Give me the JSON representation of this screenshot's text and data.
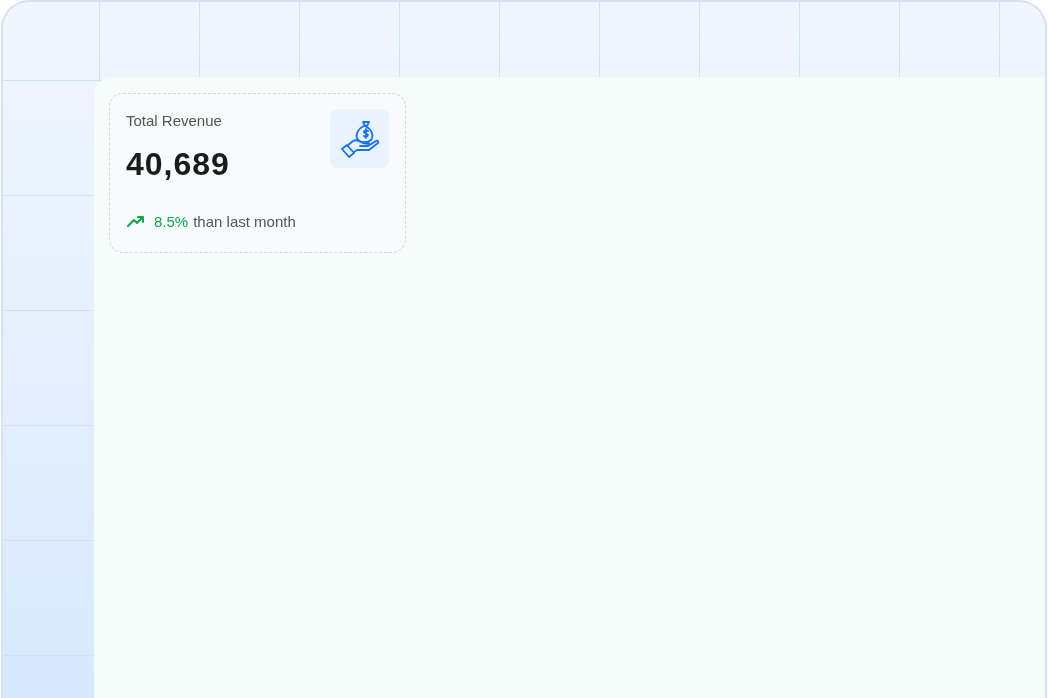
{
  "stat_card": {
    "title": "Total Revenue",
    "value": "40,689",
    "change": "8.5%",
    "rising": true,
    "comparison": "than last month"
  }
}
